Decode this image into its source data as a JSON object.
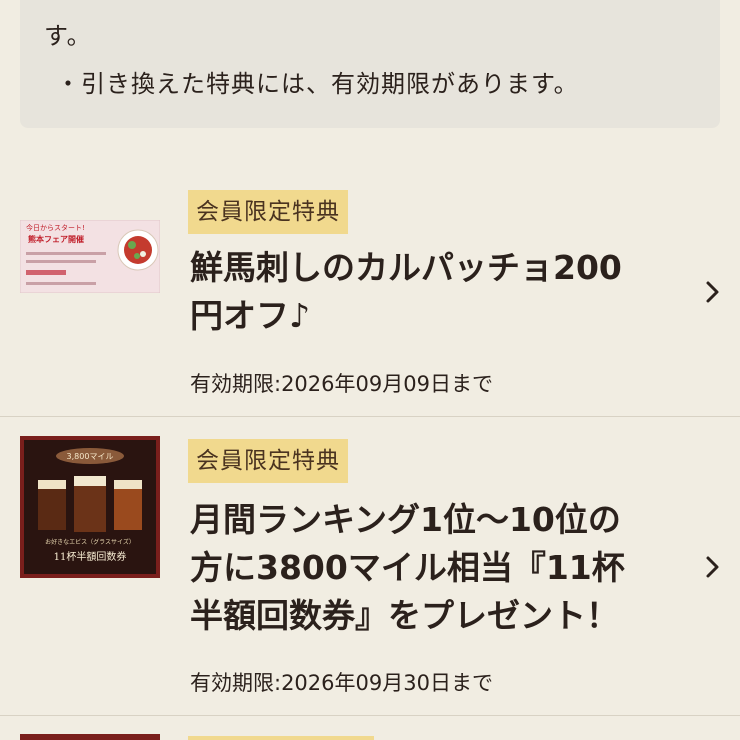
{
  "notice": {
    "line1": "す。",
    "line2": "・引き換えた特典には、有効期限があります。"
  },
  "coupons": [
    {
      "tag": "会員限定特典",
      "title_line1": "鮮馬刺しのカルパッチョ200",
      "title_line2": "円オフ♪",
      "expiry": "有効期限:2026年09月09日まで",
      "thumb": {
        "banner": "今日からスタート!",
        "sub": "熊本フェア開催"
      }
    },
    {
      "tag": "会員限定特典",
      "title_line1": "月間ランキング1位～10位の",
      "title_line2": "方に3800マイル相当『11杯",
      "title_line3": "半額回数券』をプレゼント！",
      "expiry": "有効期限:2026年09月30日まで",
      "thumb": {
        "top": "3,800マイル",
        "middle": "お好きなエビス（グラスサイズ）",
        "bottom": "11杯半額回数券"
      }
    }
  ],
  "colors": {
    "background": "#f1ede2",
    "tag_bg": "#f1d98e",
    "thumb2_frame": "#7a1f1c"
  }
}
